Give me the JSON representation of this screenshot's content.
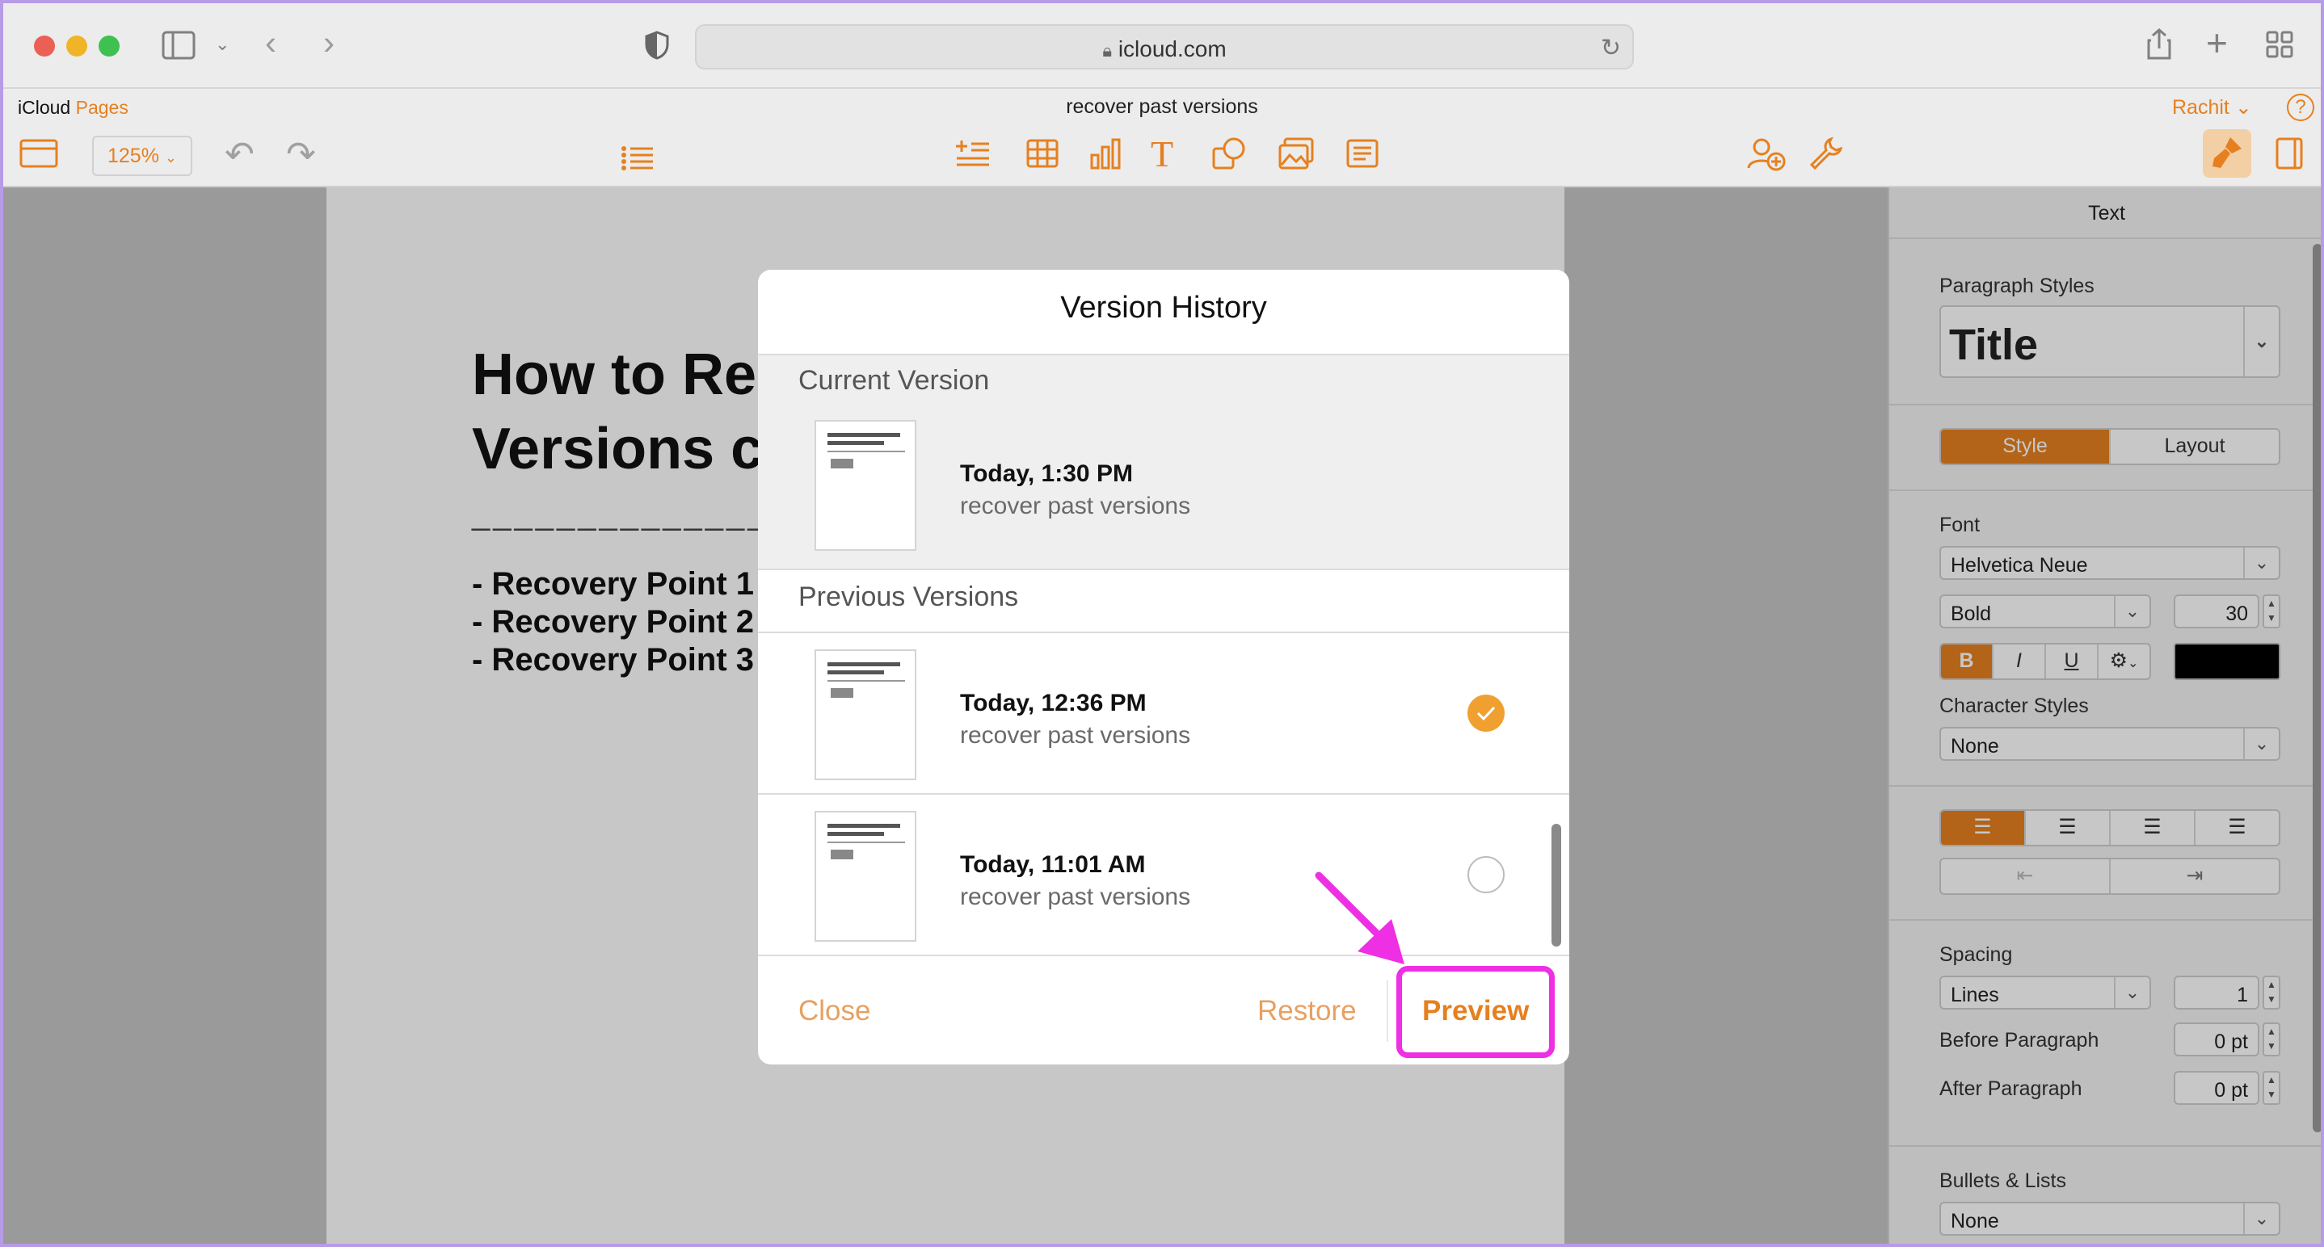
{
  "browser": {
    "url": "icloud.com",
    "traffic_lights": {
      "close": "#ec5f55",
      "minimize": "#f0b429",
      "zoom": "#3ec150"
    }
  },
  "app": {
    "brand": "iCloud",
    "app_name": "Pages",
    "doc_title": "recover past versions",
    "user": "Rachit",
    "zoom": "125%",
    "accent": "#e6801f"
  },
  "document": {
    "title_lines": [
      "How to Re",
      "Versions c"
    ],
    "separator": "______________",
    "list_items": [
      "-  Recovery Point 1",
      "-  Recovery Point 2",
      "-  Recovery Point 3"
    ]
  },
  "modal": {
    "title": "Version History",
    "current_header": "Current Version",
    "previous_header": "Previous Versions",
    "current": {
      "time": "Today, 1:30 PM",
      "name": "recover past versions"
    },
    "previous": [
      {
        "time": "Today, 12:36 PM",
        "name": "recover past versions",
        "selected": true
      },
      {
        "time": "Today, 11:01 AM",
        "name": "recover past versions",
        "selected": false
      }
    ],
    "close_label": "Close",
    "restore_label": "Restore",
    "preview_label": "Preview",
    "highlight_color": "#ee2fe4"
  },
  "sidebar": {
    "header": "Text",
    "paragraph_styles_label": "Paragraph Styles",
    "paragraph_style": "Title",
    "tab_style": "Style",
    "tab_layout": "Layout",
    "font_label": "Font",
    "font_family": "Helvetica Neue",
    "font_weight": "Bold",
    "font_size": "30",
    "fmt_bold": "B",
    "fmt_italic": "I",
    "fmt_underline": "U",
    "fmt_more": "⚙",
    "text_color": "#000000",
    "character_styles_label": "Character Styles",
    "character_style": "None",
    "spacing_label": "Spacing",
    "spacing_mode": "Lines",
    "spacing_value": "1",
    "before_paragraph_label": "Before Paragraph",
    "before_paragraph_value": "0 pt",
    "after_paragraph_label": "After Paragraph",
    "after_paragraph_value": "0 pt",
    "bullets_label": "Bullets & Lists",
    "bullets_value": "None"
  }
}
